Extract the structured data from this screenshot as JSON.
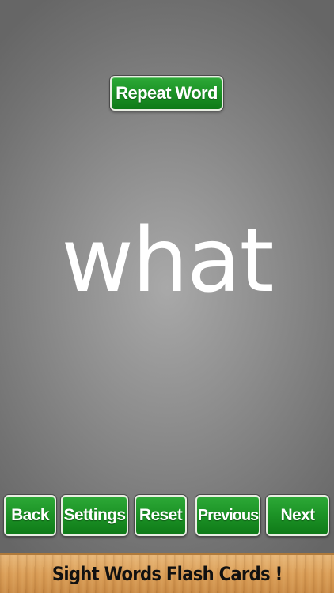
{
  "flashcard": {
    "repeat_label": "Repeat Word",
    "word": "what"
  },
  "controls": {
    "back_label": "Back",
    "settings_label": "Settings",
    "reset_label": "Reset",
    "previous_label": "Previous",
    "next_label": "Next"
  },
  "banner": {
    "title": "Sight Words Flash Cards !"
  },
  "colors": {
    "button_green": "#1d9427",
    "background_gray": "#8e8e8e",
    "banner_wood": "#d99c55",
    "word_color": "#ffffff"
  }
}
